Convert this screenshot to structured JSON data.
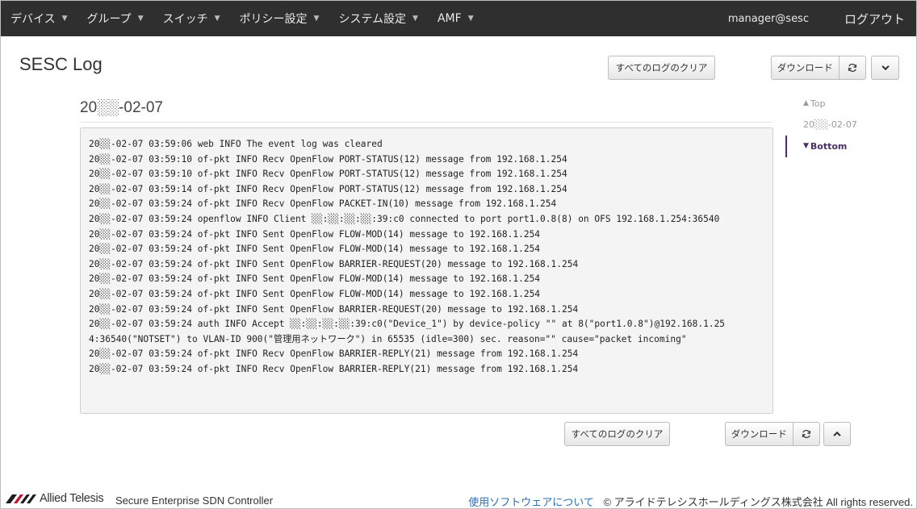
{
  "nav": {
    "items": [
      {
        "label": "デバイス"
      },
      {
        "label": "グループ"
      },
      {
        "label": "スイッチ"
      },
      {
        "label": "ポリシー設定"
      },
      {
        "label": "システム設定"
      },
      {
        "label": "AMF"
      }
    ],
    "user": "manager@sesc",
    "logout": "ログアウト"
  },
  "page": {
    "title": "SESC Log",
    "clear_all_label": "すべてのログのクリア",
    "download_label": "ダウンロード"
  },
  "log": {
    "date_heading": "20░░-02-07",
    "lines": [
      "20░░-02-07 03:59:06 web INFO The event log was cleared",
      "20░░-02-07 03:59:10 of-pkt INFO Recv OpenFlow PORT-STATUS(12) message from 192.168.1.254",
      "20░░-02-07 03:59:10 of-pkt INFO Recv OpenFlow PORT-STATUS(12) message from 192.168.1.254",
      "20░░-02-07 03:59:14 of-pkt INFO Recv OpenFlow PORT-STATUS(12) message from 192.168.1.254",
      "20░░-02-07 03:59:24 of-pkt INFO Recv OpenFlow PACKET-IN(10) message from 192.168.1.254",
      "20░░-02-07 03:59:24 openflow INFO Client ░░:░░:░░:░░:39:c0 connected to port port1.0.8(8) on OFS 192.168.1.254:36540",
      "20░░-02-07 03:59:24 of-pkt INFO Sent OpenFlow FLOW-MOD(14) message to 192.168.1.254",
      "20░░-02-07 03:59:24 of-pkt INFO Sent OpenFlow FLOW-MOD(14) message to 192.168.1.254",
      "20░░-02-07 03:59:24 of-pkt INFO Sent OpenFlow BARRIER-REQUEST(20) message to 192.168.1.254",
      "20░░-02-07 03:59:24 of-pkt INFO Sent OpenFlow FLOW-MOD(14) message to 192.168.1.254",
      "20░░-02-07 03:59:24 of-pkt INFO Sent OpenFlow FLOW-MOD(14) message to 192.168.1.254",
      "20░░-02-07 03:59:24 of-pkt INFO Sent OpenFlow BARRIER-REQUEST(20) message to 192.168.1.254",
      "20░░-02-07 03:59:24 auth INFO Accept ░░:░░:░░:░░:39:c0(\"Device_1\") by device-policy \"\" at 8(\"port1.0.8\")@192.168.1.25",
      "4:36540(\"NOTSET\") to VLAN-ID 900(\"管理用ネットワーク\") in 65535 (idle=300) sec. reason=\"\" cause=\"packet incoming\"",
      "20░░-02-07 03:59:24 of-pkt INFO Recv OpenFlow BARRIER-REPLY(21) message from 192.168.1.254",
      "20░░-02-07 03:59:24 of-pkt INFO Recv OpenFlow BARRIER-REPLY(21) message from 192.168.1.254"
    ]
  },
  "side_nav": {
    "top": "Top",
    "date": "20░░-02-07",
    "bottom": "Bottom"
  },
  "footer": {
    "logo_text": "Allied Telesis",
    "product": "Secure Enterprise SDN Controller",
    "software_link": "使用ソフトウェアについて",
    "copyright": "© アライドテレシスホールディングス株式会社 All rights reserved."
  },
  "icons": {
    "caret": "caret-down-icon",
    "refresh": "refresh-icon",
    "chevron_down": "chevron-down-icon",
    "chevron_up": "chevron-up-icon",
    "logo": "allied-telesis-logo-icon"
  },
  "colors": {
    "navbar_bg": "#2f2f2f",
    "accent": "#4b2f66",
    "link": "#2a6ebb",
    "log_bg": "#f4f4f4"
  }
}
